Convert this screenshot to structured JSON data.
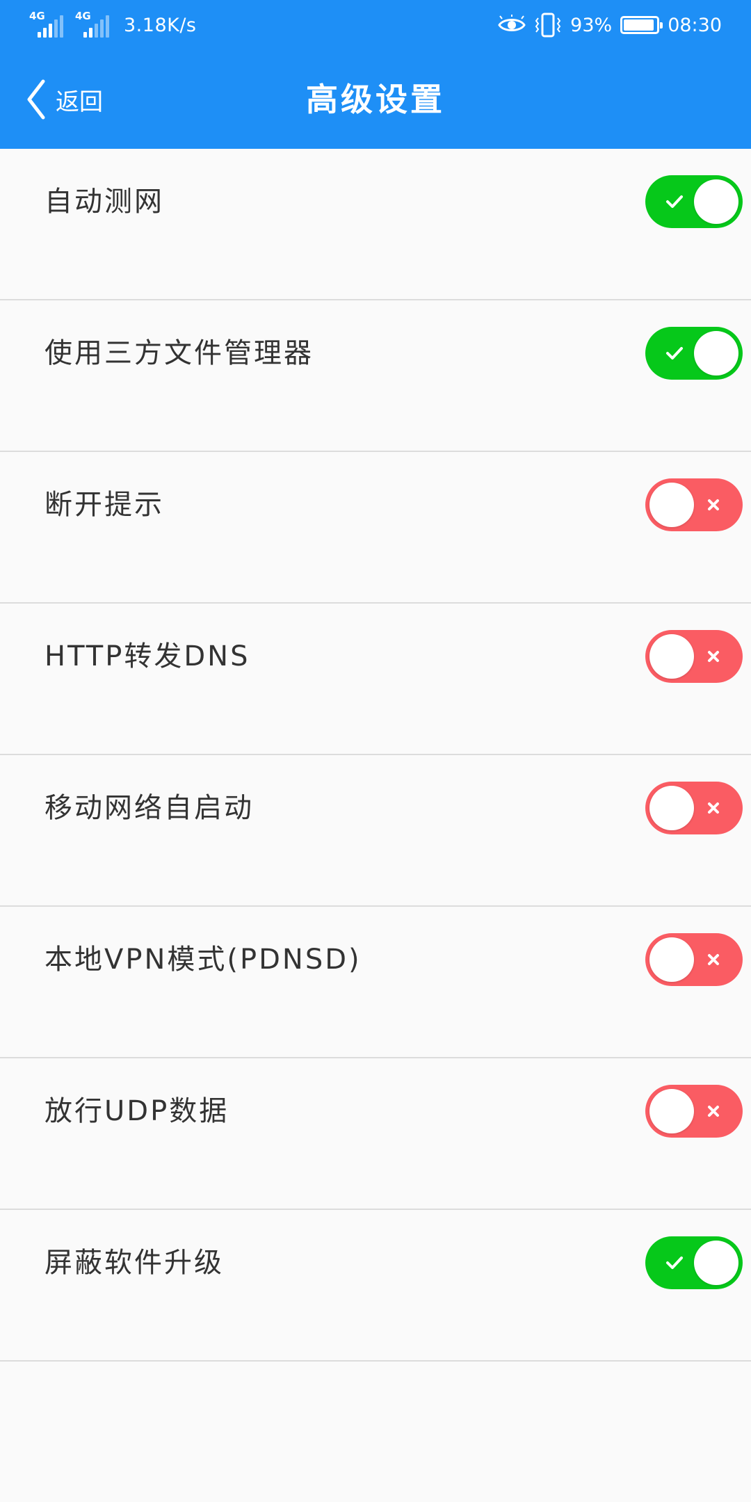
{
  "status_bar": {
    "network_1": "4G",
    "network_2": "4G",
    "speed": "3.18K/s",
    "battery_percent": "93%",
    "battery_level": 0.93,
    "time": "08:30",
    "icons": [
      "eye-icon",
      "vibrate-icon",
      "battery-icon"
    ]
  },
  "title_bar": {
    "back_label": "返回",
    "title": "高级设置",
    "color": "#1e8ff6"
  },
  "colors": {
    "toggle_on": "#06c81a",
    "toggle_off": "#fa5c63"
  },
  "settings": [
    {
      "label": "自动测网",
      "enabled": true
    },
    {
      "label": "使用三方文件管理器",
      "enabled": true
    },
    {
      "label": "断开提示",
      "enabled": false
    },
    {
      "label": "HTTP转发DNS",
      "enabled": false
    },
    {
      "label": "移动网络自启动",
      "enabled": false
    },
    {
      "label": "本地VPN模式(PDNSD)",
      "enabled": false
    },
    {
      "label": "放行UDP数据",
      "enabled": false
    },
    {
      "label": "屏蔽软件升级",
      "enabled": true
    }
  ]
}
